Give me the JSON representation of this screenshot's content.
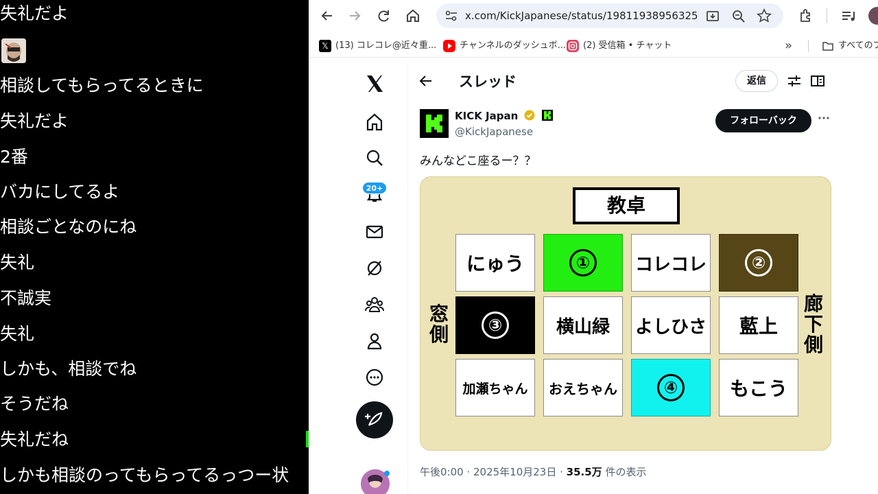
{
  "chat": {
    "lines": [
      "失礼だよ",
      "相談してもらってるときに",
      "失礼だよ",
      "2番",
      "バカにしてるよ",
      "相談ごとなのにね",
      "失礼",
      "不誠実",
      "失礼",
      "しかも、相談でね",
      "そうだね",
      "失礼だね",
      "しかも相談のってもらってるっつー状"
    ]
  },
  "browser": {
    "url": "x.com/KickJapanese/status/19811938956325...",
    "bookmarks": [
      {
        "label": "(13) コレコレ@近々重...",
        "icon": "x-icon"
      },
      {
        "label": "チャンネルのダッシュボ...",
        "icon": "youtube-icon"
      },
      {
        "label": "(2) 受信箱 • チャット",
        "icon": "instagram-icon"
      },
      {
        "label": "すべてのブ",
        "icon": "folder-icon"
      }
    ],
    "more_bookmarks": "»"
  },
  "x": {
    "notification_badge": "20+",
    "thread_title": "スレッド",
    "reply_label": "返信",
    "post": {
      "name": "KICK Japan",
      "handle": "@KickJapanese",
      "follow_label": "フォローバック",
      "text": "みんなどこ座るー？？",
      "time": "午後0:00 · 2025年10月23日 · ",
      "views": "35.5万",
      "views_suffix": " 件の表示"
    },
    "seating": {
      "podium": "教卓",
      "left_side": "窓側",
      "right_side": "廊下側",
      "rows": [
        [
          "にゅう",
          "①",
          "コレコレ",
          "②"
        ],
        [
          "③",
          "横山緑",
          "よしひさ",
          "藍上"
        ],
        [
          "加瀬ちゃん",
          "おえちゃん",
          "④",
          "もこう"
        ]
      ]
    }
  }
}
